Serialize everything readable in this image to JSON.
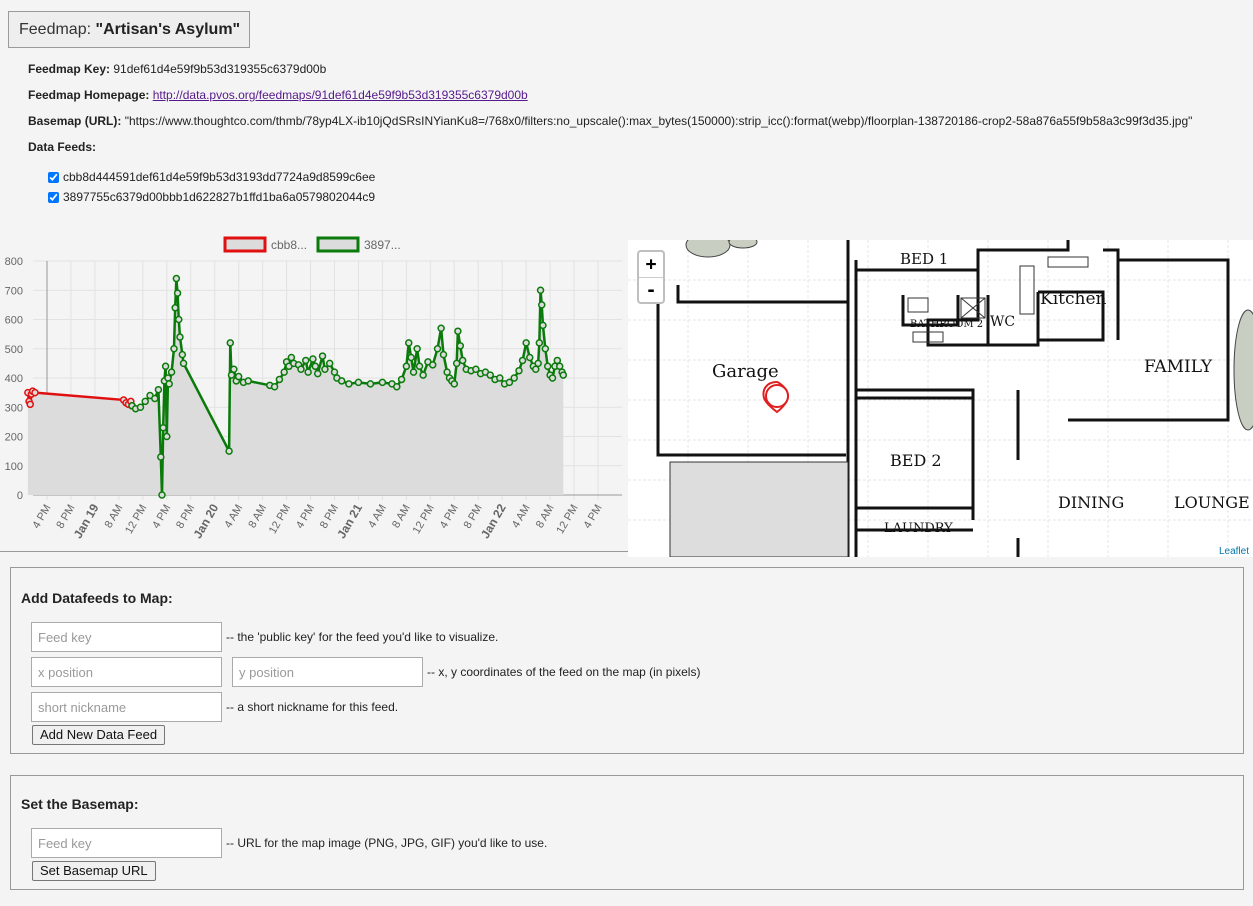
{
  "header": {
    "prefix": "Feedmap: ",
    "name": "\"Artisan's Asylum\""
  },
  "info": {
    "key_label": "Feedmap Key:",
    "key_value": "91def61d4e59f9b53d319355c6379d00b",
    "homepage_label": "Feedmap Homepage:",
    "homepage_url": "http://data.pvos.org/feedmaps/91def61d4e59f9b53d319355c6379d00b",
    "basemap_label": "Basemap (URL):",
    "basemap_value": "\"https://www.thoughtco.com/thmb/78yp4LX-ib10jQdSRsINYianKu8=/768x0/filters:no_upscale():max_bytes(150000):strip_icc():format(webp)/floorplan-138720186-crop2-58a876a55f9b58a3c99f3d35.jpg\"",
    "datafeeds_label": "Data Feeds:"
  },
  "feeds": [
    {
      "id": "cbb8d444591def61d4e59f9b53d3193dd7724a9d8599c6ee",
      "checked": true
    },
    {
      "id": "3897755c6379d00bbb1d622827b1ffd1ba6a0579802044c9",
      "checked": true
    }
  ],
  "chart_data": {
    "type": "line",
    "ylim": [
      0,
      800
    ],
    "yticks": [
      "0",
      "100",
      "200",
      "300",
      "400",
      "500",
      "600",
      "700",
      "800"
    ],
    "xtick_labels": [
      "4 PM",
      "8 PM",
      "Jan 19",
      "8 AM",
      "12 PM",
      "4 PM",
      "8 PM",
      "Jan 20",
      "4 AM",
      "8 AM",
      "12 PM",
      "4 PM",
      "8 PM",
      "Jan 21",
      "4 AM",
      "8 AM",
      "12 PM",
      "4 PM",
      "8 PM",
      "Jan 22",
      "4 AM",
      "8 AM",
      "12 PM",
      "4 PM"
    ],
    "bold_ticks": [
      "Jan 19",
      "Jan 20",
      "Jan 21",
      "Jan 22"
    ],
    "colors": {
      "series1": "#e01010",
      "series2": "#0a7a0a",
      "fill": "#dcdcdc"
    },
    "series": [
      {
        "name": "cbb8...",
        "values": [
          {
            "x": -0.8,
            "y": 350
          },
          {
            "x": -0.75,
            "y": 320
          },
          {
            "x": -0.7,
            "y": 310
          },
          {
            "x": -0.65,
            "y": 345
          },
          {
            "x": -0.6,
            "y": 355
          },
          {
            "x": -0.5,
            "y": 350
          },
          {
            "x": 3.2,
            "y": 325
          },
          {
            "x": 3.3,
            "y": 315
          },
          {
            "x": 3.4,
            "y": 310
          },
          {
            "x": 3.5,
            "y": 320
          },
          {
            "x": 3.55,
            "y": 305
          }
        ]
      },
      {
        "name": "3897...",
        "values": [
          {
            "x": 3.55,
            "y": 305
          },
          {
            "x": 3.7,
            "y": 295
          },
          {
            "x": 3.9,
            "y": 300
          },
          {
            "x": 4.1,
            "y": 320
          },
          {
            "x": 4.3,
            "y": 340
          },
          {
            "x": 4.5,
            "y": 330
          },
          {
            "x": 4.65,
            "y": 360
          },
          {
            "x": 4.75,
            "y": 130
          },
          {
            "x": 4.8,
            "y": 0
          },
          {
            "x": 4.85,
            "y": 230
          },
          {
            "x": 4.9,
            "y": 390
          },
          {
            "x": 4.95,
            "y": 440
          },
          {
            "x": 5.0,
            "y": 200
          },
          {
            "x": 5.05,
            "y": 400
          },
          {
            "x": 5.1,
            "y": 380
          },
          {
            "x": 5.2,
            "y": 420
          },
          {
            "x": 5.3,
            "y": 500
          },
          {
            "x": 5.35,
            "y": 640
          },
          {
            "x": 5.4,
            "y": 740
          },
          {
            "x": 5.45,
            "y": 690
          },
          {
            "x": 5.5,
            "y": 600
          },
          {
            "x": 5.55,
            "y": 540
          },
          {
            "x": 5.65,
            "y": 480
          },
          {
            "x": 5.7,
            "y": 450
          },
          {
            "x": 7.6,
            "y": 150
          },
          {
            "x": 7.65,
            "y": 520
          },
          {
            "x": 7.7,
            "y": 410
          },
          {
            "x": 7.8,
            "y": 430
          },
          {
            "x": 7.9,
            "y": 390
          },
          {
            "x": 8.0,
            "y": 405
          },
          {
            "x": 8.2,
            "y": 385
          },
          {
            "x": 8.4,
            "y": 390
          },
          {
            "x": 9.3,
            "y": 375
          },
          {
            "x": 9.5,
            "y": 370
          },
          {
            "x": 9.7,
            "y": 395
          },
          {
            "x": 9.9,
            "y": 420
          },
          {
            "x": 10.0,
            "y": 455
          },
          {
            "x": 10.1,
            "y": 440
          },
          {
            "x": 10.2,
            "y": 470
          },
          {
            "x": 10.3,
            "y": 450
          },
          {
            "x": 10.5,
            "y": 445
          },
          {
            "x": 10.6,
            "y": 430
          },
          {
            "x": 10.8,
            "y": 460
          },
          {
            "x": 10.9,
            "y": 420
          },
          {
            "x": 11.1,
            "y": 465
          },
          {
            "x": 11.2,
            "y": 440
          },
          {
            "x": 11.3,
            "y": 415
          },
          {
            "x": 11.5,
            "y": 475
          },
          {
            "x": 11.6,
            "y": 430
          },
          {
            "x": 11.8,
            "y": 450
          },
          {
            "x": 12.0,
            "y": 420
          },
          {
            "x": 12.1,
            "y": 400
          },
          {
            "x": 12.3,
            "y": 390
          },
          {
            "x": 12.6,
            "y": 380
          },
          {
            "x": 13.0,
            "y": 385
          },
          {
            "x": 13.5,
            "y": 380
          },
          {
            "x": 14.0,
            "y": 385
          },
          {
            "x": 14.4,
            "y": 380
          },
          {
            "x": 14.6,
            "y": 370
          },
          {
            "x": 14.8,
            "y": 395
          },
          {
            "x": 15.0,
            "y": 440
          },
          {
            "x": 15.1,
            "y": 520
          },
          {
            "x": 15.2,
            "y": 470
          },
          {
            "x": 15.3,
            "y": 420
          },
          {
            "x": 15.45,
            "y": 500
          },
          {
            "x": 15.55,
            "y": 440
          },
          {
            "x": 15.7,
            "y": 410
          },
          {
            "x": 15.9,
            "y": 455
          },
          {
            "x": 16.1,
            "y": 445
          },
          {
            "x": 16.3,
            "y": 500
          },
          {
            "x": 16.45,
            "y": 570
          },
          {
            "x": 16.55,
            "y": 480
          },
          {
            "x": 16.7,
            "y": 420
          },
          {
            "x": 16.8,
            "y": 400
          },
          {
            "x": 16.9,
            "y": 390
          },
          {
            "x": 17.0,
            "y": 380
          },
          {
            "x": 17.1,
            "y": 450
          },
          {
            "x": 17.15,
            "y": 560
          },
          {
            "x": 17.25,
            "y": 510
          },
          {
            "x": 17.35,
            "y": 460
          },
          {
            "x": 17.5,
            "y": 430
          },
          {
            "x": 17.7,
            "y": 425
          },
          {
            "x": 17.9,
            "y": 430
          },
          {
            "x": 18.1,
            "y": 415
          },
          {
            "x": 18.3,
            "y": 420
          },
          {
            "x": 18.5,
            "y": 410
          },
          {
            "x": 18.7,
            "y": 395
          },
          {
            "x": 18.9,
            "y": 400
          },
          {
            "x": 19.1,
            "y": 380
          },
          {
            "x": 19.3,
            "y": 385
          },
          {
            "x": 19.5,
            "y": 400
          },
          {
            "x": 19.7,
            "y": 425
          },
          {
            "x": 19.85,
            "y": 460
          },
          {
            "x": 20.0,
            "y": 520
          },
          {
            "x": 20.15,
            "y": 470
          },
          {
            "x": 20.3,
            "y": 440
          },
          {
            "x": 20.4,
            "y": 430
          },
          {
            "x": 20.5,
            "y": 450
          },
          {
            "x": 20.55,
            "y": 520
          },
          {
            "x": 20.6,
            "y": 700
          },
          {
            "x": 20.65,
            "y": 650
          },
          {
            "x": 20.7,
            "y": 580
          },
          {
            "x": 20.8,
            "y": 500
          },
          {
            "x": 20.9,
            "y": 440
          },
          {
            "x": 21.0,
            "y": 410
          },
          {
            "x": 21.1,
            "y": 400
          },
          {
            "x": 21.2,
            "y": 440
          },
          {
            "x": 21.3,
            "y": 460
          },
          {
            "x": 21.4,
            "y": 440
          },
          {
            "x": 21.5,
            "y": 420
          },
          {
            "x": 21.55,
            "y": 410
          }
        ]
      }
    ]
  },
  "map": {
    "zoom_in": "+",
    "zoom_out": "-",
    "attribution": "Leaflet",
    "rooms": [
      "BED 1",
      "Kitchen",
      "BATHROOM 2",
      "WC",
      "Garage",
      "FAMILY",
      "BED 2",
      "DINING",
      "LOUNGE",
      "LAUNDRY"
    ],
    "marker_color": "#e02020"
  },
  "add_form": {
    "title": "Add Datafeeds to Map:",
    "feedkey_placeholder": "Feed key",
    "feedkey_hint": "-- the 'public key' for the feed you'd like to visualize.",
    "x_placeholder": "x position",
    "y_placeholder": "y position",
    "xy_hint": "-- x, y coordinates of the feed on the map (in pixels)",
    "nick_placeholder": "short nickname",
    "nick_hint": "-- a short nickname for this feed.",
    "button": "Add New Data Feed"
  },
  "basemap_form": {
    "title": "Set the Basemap:",
    "url_placeholder": "Feed key",
    "url_hint": "-- URL for the map image (PNG, JPG, GIF) you'd like to use.",
    "button": "Set Basemap URL"
  }
}
